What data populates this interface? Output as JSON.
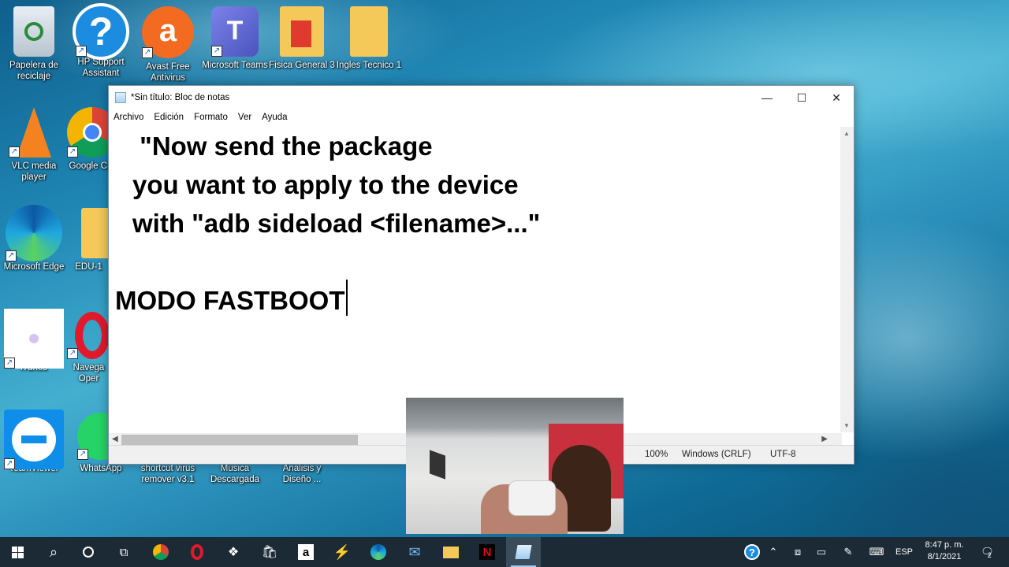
{
  "desktop_icons": [
    {
      "label": "Papelera de reciclaje",
      "icon": "recycle-bin-icon"
    },
    {
      "label": "HP Support Assistant",
      "icon": "question-icon"
    },
    {
      "label": "Avast Free Antivirus",
      "icon": "avast-icon"
    },
    {
      "label": "Microsoft Teams",
      "icon": "teams-icon"
    },
    {
      "label": "Fisica General 3",
      "icon": "pdf-folder-icon"
    },
    {
      "label": "Ingles Tecnico 1",
      "icon": "folder-icon"
    },
    {
      "label": "VLC media player",
      "icon": "vlc-icon"
    },
    {
      "label": "Google Ch",
      "icon": "chrome-icon"
    },
    {
      "label": "Microsoft Edge",
      "icon": "edge-icon"
    },
    {
      "label": "EDU-1",
      "icon": "folder-icon"
    },
    {
      "label": "iTunes",
      "icon": "itunes-icon"
    },
    {
      "label": "Navega Oper",
      "icon": "opera-icon"
    },
    {
      "label": "TeamViewer",
      "icon": "teamviewer-icon"
    },
    {
      "label": "WhatsApp",
      "icon": "whatsapp-icon"
    },
    {
      "label": "shortcut virus remover v3.1",
      "icon": "app-icon"
    },
    {
      "label": "Musica Descargada",
      "icon": "folder-icon"
    },
    {
      "label": "Analisis y Diseño ...",
      "icon": "folder-icon"
    }
  ],
  "notepad": {
    "title": "*Sin título: Bloc de notas",
    "menu": [
      "Archivo",
      "Edición",
      "Formato",
      "Ver",
      "Ayuda"
    ],
    "lines": [
      " \"Now send the package",
      "you want to apply to the device",
      "with \"adb sideload <filename>...\"",
      "MODO FASTBOOT"
    ],
    "status": {
      "zoom": "100%",
      "line_ending": "Windows (CRLF)",
      "encoding": "UTF-8"
    }
  },
  "tray": {
    "language": "ESP",
    "time": "8:47 p. m.",
    "date": "8/1/2021",
    "notifications": "2"
  }
}
